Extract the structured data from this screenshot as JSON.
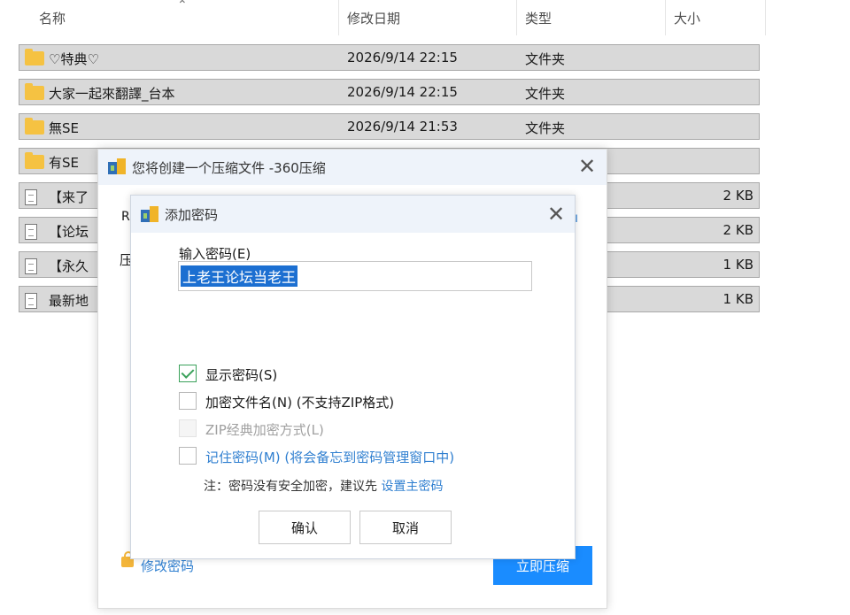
{
  "explorer": {
    "columns": {
      "name": "名称",
      "date": "修改日期",
      "type": "类型",
      "size": "大小"
    },
    "rows": [
      {
        "name": "♡特典♡",
        "date": "2026/9/14 22:15",
        "type": "文件夹",
        "size": "",
        "icon": "folder-icon"
      },
      {
        "name": "大家一起來翻譯_台本",
        "date": "2026/9/14 22:15",
        "type": "文件夹",
        "size": "",
        "icon": "folder-icon"
      },
      {
        "name": "無SE",
        "date": "2026/9/14 21:53",
        "type": "文件夹",
        "size": "",
        "icon": "folder-icon"
      },
      {
        "name": "有SE",
        "date": "",
        "type": "",
        "size": "",
        "icon": "folder-icon"
      },
      {
        "name": "【来了",
        "date": "",
        "type": "",
        "size": "2 KB",
        "icon": "file-icon"
      },
      {
        "name": "【论坛",
        "date": "",
        "type": "",
        "size": "2 KB",
        "icon": "file-icon"
      },
      {
        "name": "【永久",
        "date": "",
        "type": "",
        "size": "1 KB",
        "icon": "file-icon"
      },
      {
        "name": "最新地",
        "date": "",
        "type": "",
        "size": "1 KB",
        "icon": "file-icon"
      }
    ]
  },
  "outer_dialog": {
    "title": "您将创建一个压缩文件 -360压缩",
    "partial_field": "R",
    "label_prefix": "压",
    "modify_password": "修改密码",
    "start_compress": "立即压缩"
  },
  "password_dialog": {
    "title": "添加密码",
    "input_label": "输入密码(E)",
    "password_value": "上老王论坛当老王",
    "options": [
      {
        "label": "显示密码(S)",
        "checked": true,
        "disabled": false
      },
      {
        "label": "加密文件名(N) (不支持ZIP格式)",
        "checked": false,
        "disabled": false
      },
      {
        "label": "ZIP经典加密方式(L)",
        "checked": false,
        "disabled": true
      },
      {
        "label": "记住密码(M) (将会备忘到密码管理窗口中)",
        "checked": false,
        "disabled": false
      }
    ],
    "note_text": "注：密码没有安全加密，建议先 ",
    "note_link": "设置主密码",
    "confirm": "确认",
    "cancel": "取消"
  },
  "colors": {
    "accent": "#1a8cff",
    "link": "#2f7fd0",
    "check": "#3aa15a",
    "row_bg": "#d9d9d9"
  }
}
